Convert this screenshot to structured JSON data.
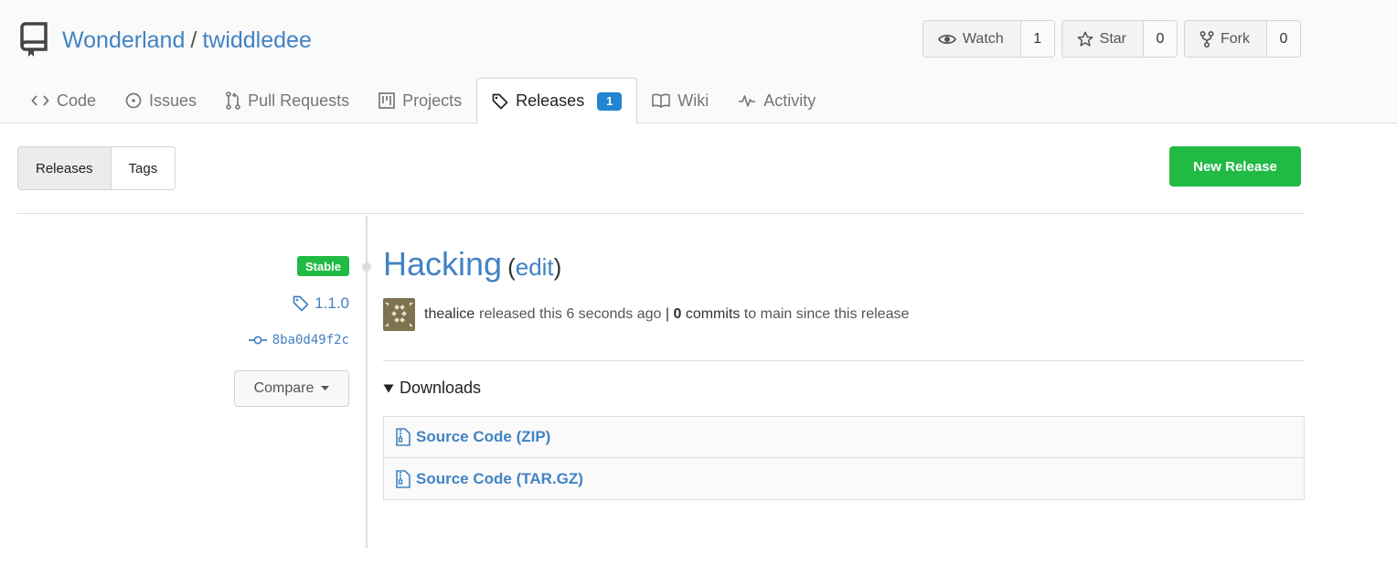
{
  "repo": {
    "owner": "Wonderland",
    "separator": "/",
    "name": "twiddledee"
  },
  "actions": {
    "watch": {
      "label": "Watch",
      "count": "1"
    },
    "star": {
      "label": "Star",
      "count": "0"
    },
    "fork": {
      "label": "Fork",
      "count": "0"
    }
  },
  "tabs": [
    {
      "label": "Code",
      "icon": "code-icon"
    },
    {
      "label": "Issues",
      "icon": "issue-icon"
    },
    {
      "label": "Pull Requests",
      "icon": "pull-request-icon"
    },
    {
      "label": "Projects",
      "icon": "project-icon"
    },
    {
      "label": "Releases",
      "icon": "tag-icon",
      "badge": "1",
      "active": true
    },
    {
      "label": "Wiki",
      "icon": "book-icon"
    },
    {
      "label": "Activity",
      "icon": "pulse-icon"
    }
  ],
  "toolbar": {
    "releases_label": "Releases",
    "tags_label": "Tags",
    "new_release_label": "New Release"
  },
  "release": {
    "status_badge": "Stable",
    "tag": "1.1.0",
    "commit": "8ba0d49f2c",
    "compare_label": "Compare",
    "title": "Hacking",
    "paren_open": "(",
    "edit_label": "edit",
    "paren_close": ")",
    "author": "thealice",
    "released_text": "released this 6 seconds ago",
    "separator": "|",
    "commits_count": "0",
    "commits_label": "commits",
    "to_branch_text": "to main since this release",
    "downloads_label": "Downloads",
    "downloads": [
      {
        "label": "Source Code (ZIP)"
      },
      {
        "label": "Source Code (TAR.GZ)"
      }
    ]
  },
  "colors": {
    "link": "#4183c4",
    "green": "#21ba45",
    "badge_blue": "#2185d0",
    "border": "#d4d4d5"
  }
}
